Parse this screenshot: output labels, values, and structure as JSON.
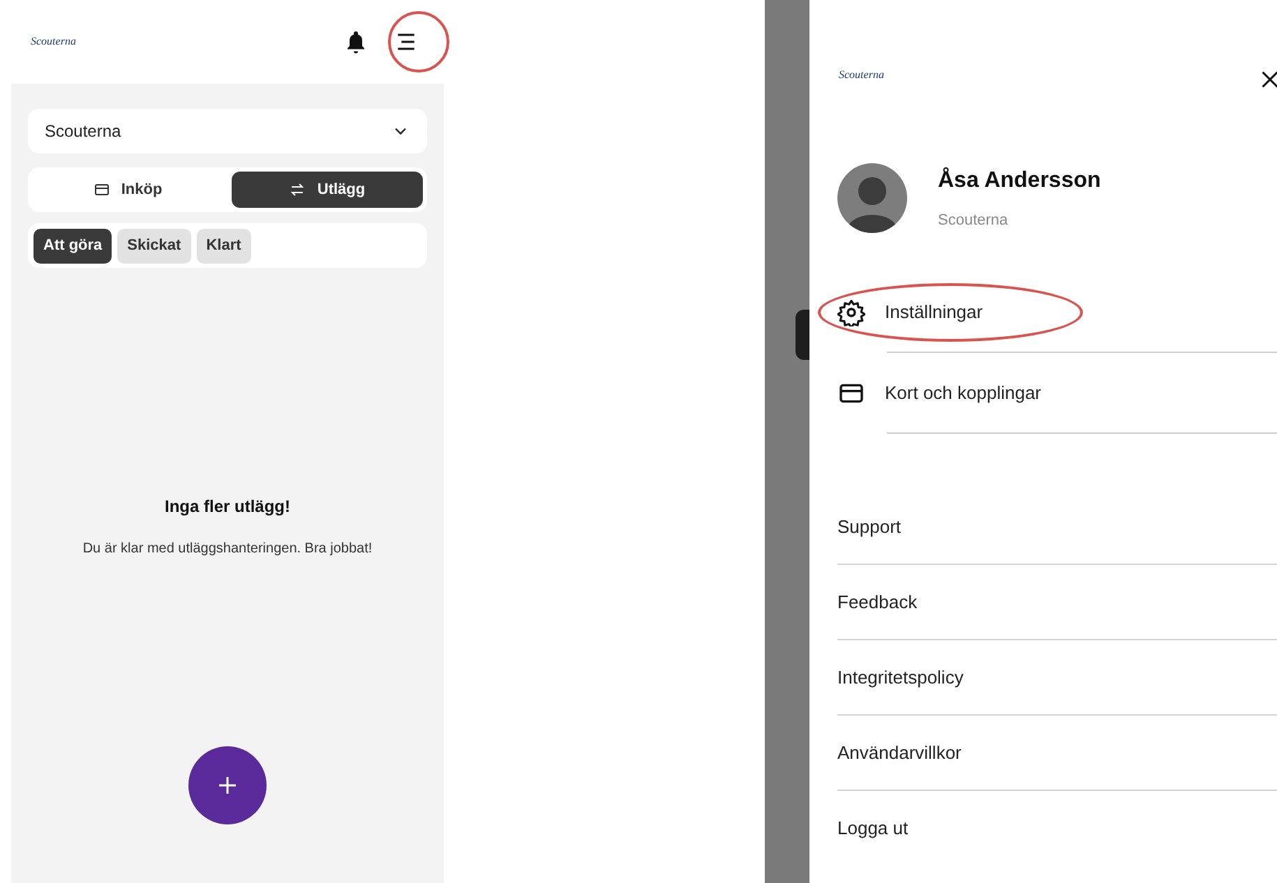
{
  "main_screen": {
    "logo": "Scouterna",
    "menu_button": {
      "annotated": true
    },
    "organization_select": {
      "value": "Scouterna"
    },
    "segments": [
      {
        "label": "Inköp",
        "kind": "card",
        "selected": false
      },
      {
        "label": "Utlägg",
        "kind": "transfer",
        "selected": true
      }
    ],
    "filters": [
      {
        "label": "Att göra",
        "selected": true
      },
      {
        "label": "Skickat",
        "selected": false
      },
      {
        "label": "Klart",
        "selected": false
      }
    ],
    "empty_state": {
      "title": "Inga fler utlägg!",
      "message": "Du är klar med utläggshanteringen. Bra jobbat!"
    }
  },
  "menu_screen": {
    "logo": "Scouterna",
    "profile": {
      "name": "Åsa Andersson",
      "organization": "Scouterna"
    },
    "items": [
      {
        "label": "Inställningar",
        "kind": "settings",
        "annotated": true
      },
      {
        "label": "Kort och kopplingar",
        "kind": "card",
        "annotated": false
      }
    ],
    "links": [
      {
        "label": "Support"
      },
      {
        "label": "Feedback"
      },
      {
        "label": "Integritetspolicy"
      },
      {
        "label": "Användarvillkor"
      },
      {
        "label": "Logga ut"
      }
    ]
  }
}
